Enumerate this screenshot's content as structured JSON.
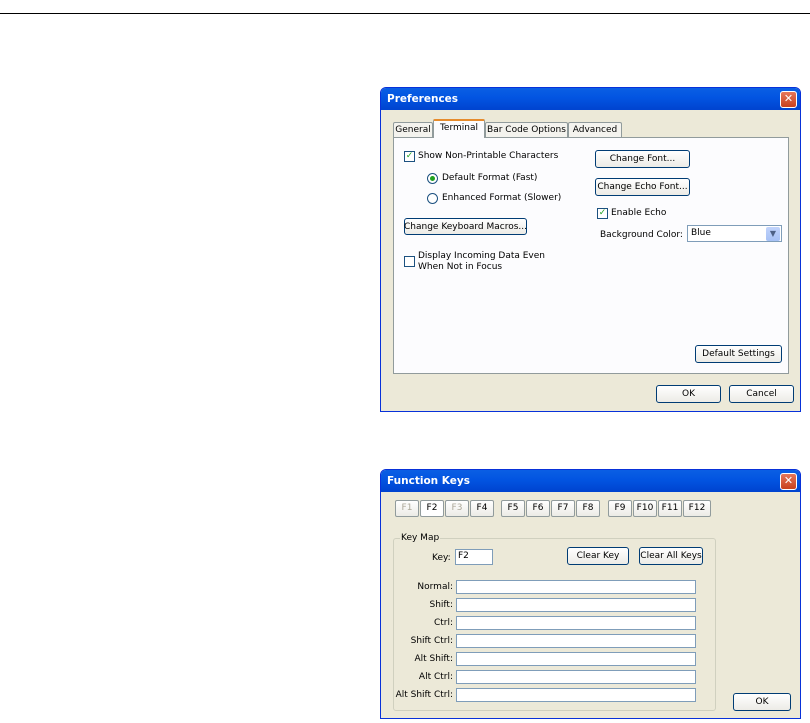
{
  "preferences": {
    "title": "Preferences",
    "close_label": "✕",
    "tabs": [
      {
        "label": "General",
        "active": false
      },
      {
        "label": "Terminal",
        "active": true
      },
      {
        "label": "Bar Code Options",
        "active": false
      },
      {
        "label": "Advanced",
        "active": false
      }
    ],
    "show_nonprintable": {
      "label": "Show Non-Printable Characters",
      "checked": true
    },
    "format_default": {
      "label": "Default Format (Fast)",
      "selected": true
    },
    "format_enhanced": {
      "label": "Enhanced Format (Slower)",
      "selected": false
    },
    "change_keyboard_macros": "Change Keyboard Macros...",
    "display_incoming": {
      "label_line1": "Display Incoming Data Even",
      "label_line2": "When Not in Focus",
      "checked": false
    },
    "change_font": "Change Font...",
    "change_echo_font": "Change Echo Font...",
    "enable_echo": {
      "label": "Enable Echo",
      "checked": true
    },
    "background_color": {
      "label": "Background Color:",
      "value": "Blue"
    },
    "default_settings": "Default Settings",
    "ok": "OK",
    "cancel": "Cancel"
  },
  "function_keys": {
    "title": "Function Keys",
    "close_label": "✕",
    "keys": [
      {
        "label": "F1",
        "state": "disabled"
      },
      {
        "label": "F2",
        "state": "active"
      },
      {
        "label": "F3",
        "state": "disabled"
      },
      {
        "label": "F4",
        "state": "normal"
      },
      {
        "label": "F5",
        "state": "normal"
      },
      {
        "label": "F6",
        "state": "normal"
      },
      {
        "label": "F7",
        "state": "normal"
      },
      {
        "label": "F8",
        "state": "normal"
      },
      {
        "label": "F9",
        "state": "normal"
      },
      {
        "label": "F10",
        "state": "normal"
      },
      {
        "label": "F11",
        "state": "normal"
      },
      {
        "label": "F12",
        "state": "normal"
      }
    ],
    "key_map": {
      "group_label": "Key Map",
      "key_label": "Key:",
      "key_value": "F2",
      "clear_key": "Clear Key",
      "clear_all_keys": "Clear All Keys",
      "rows": [
        {
          "label": "Normal:",
          "value": ""
        },
        {
          "label": "Shift:",
          "value": ""
        },
        {
          "label": "Ctrl:",
          "value": ""
        },
        {
          "label": "Shift Ctrl:",
          "value": ""
        },
        {
          "label": "Alt Shift:",
          "value": ""
        },
        {
          "label": "Alt Ctrl:",
          "value": ""
        },
        {
          "label": "Alt Shift Ctrl:",
          "value": ""
        }
      ]
    },
    "ok": "OK"
  }
}
